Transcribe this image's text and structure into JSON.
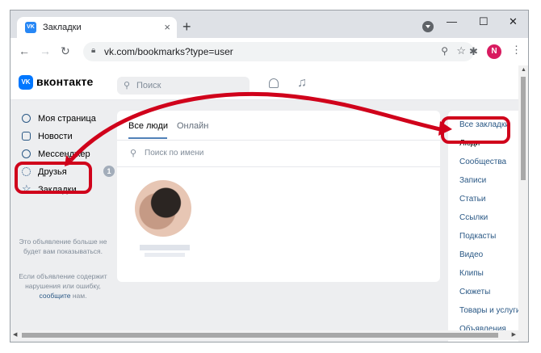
{
  "browser": {
    "tab_title": "Закладки",
    "favicon_text": "VK",
    "url": "vk.com/bookmarks?type=user",
    "profile_initial": "N",
    "controls": {
      "minimize": "—",
      "maximize": "☐",
      "close": "✕"
    }
  },
  "vk": {
    "brand": "вконтакте",
    "logo_text": "VK",
    "search_placeholder": "Поиск"
  },
  "left_nav": {
    "items": [
      {
        "label": "Моя страница",
        "icon": "user-circle-icon"
      },
      {
        "label": "Новости",
        "icon": "news-icon"
      },
      {
        "label": "Мессенджер",
        "icon": "chat-icon"
      },
      {
        "label": "Друзья",
        "icon": "friends-icon"
      },
      {
        "label": "Закладки",
        "icon": "star-icon"
      }
    ],
    "friends_badge": "1",
    "ad_note_1": "Это объявление больше не будет вам показываться.",
    "ad_note_2a": "Если объявление содержит нарушения или ошибку, ",
    "ad_note_2b": "сообщите",
    "ad_note_2c": " нам."
  },
  "main": {
    "tabs": [
      {
        "label": "Все люди",
        "active": true
      },
      {
        "label": "Онлайн",
        "active": false
      }
    ],
    "name_search_placeholder": "Поиск по имени"
  },
  "right_nav": {
    "items": [
      "Все закладки",
      "Люди",
      "Сообщества",
      "Записи",
      "Статьи",
      "Ссылки",
      "Подкасты",
      "Видео",
      "Клипы",
      "Сюжеты",
      "Товары и услуги",
      "Объявления"
    ]
  },
  "colors": {
    "accent": "#0077ff",
    "link": "#2a5885",
    "annotation": "#d0021b"
  }
}
